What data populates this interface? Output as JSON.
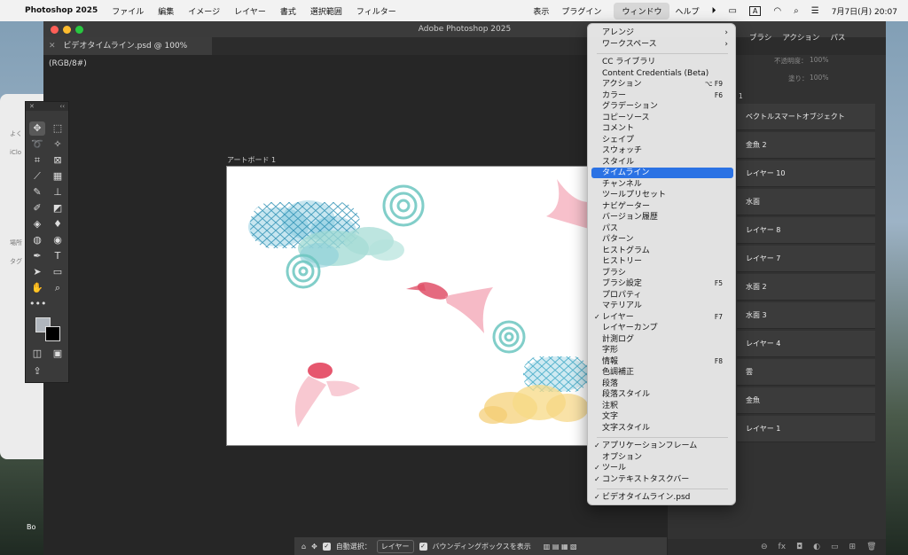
{
  "menubar": {
    "app_name": "Photoshop 2025",
    "left_items": [
      "ファイル",
      "編集",
      "イメージ",
      "レイヤー",
      "書式",
      "選択範囲",
      "フィルター"
    ],
    "right_items": [
      "表示",
      "プラグイン"
    ],
    "active_item": "ウィンドウ",
    "help": "ヘルプ",
    "input_indicator": "A",
    "datetime": "7月7日(月)  20:07"
  },
  "window": {
    "title": "Adobe Photoshop 2025",
    "document_tab": "ビデオタイムライン.psd @ 100% (RGB/8#)",
    "artboard_label": "アートボード 1"
  },
  "panels": {
    "tabs": [
      "ブラシ",
      "アクション",
      "パス"
    ],
    "opacity_label": "不透明度：",
    "opacity_value": "100%",
    "fill_label": "塗り：",
    "fill_value": "100%",
    "group_label": "1",
    "layers": [
      "ベクトルスマートオブジェクト",
      "金魚 2",
      "レイヤー 10",
      "水面",
      "レイヤー 8",
      "レイヤー 7",
      "水面 2",
      "水面 3",
      "レイヤー 4",
      "雲",
      "金魚",
      "レイヤー 1"
    ]
  },
  "finder": {
    "labels": [
      "よく",
      "iClo",
      "場所",
      "タグ"
    ],
    "dock_label": "Bo"
  },
  "optionsbar": {
    "auto_select_label": "自動選択：",
    "auto_select_value": "レイヤー",
    "bounding_box_label": "バウンディングボックスを表示"
  },
  "window_menu": {
    "items": [
      {
        "label": "アレンジ",
        "submenu": true
      },
      {
        "label": "ワークスペース",
        "submenu": true
      },
      {
        "separator": true
      },
      {
        "label": "CC ライブラリ"
      },
      {
        "label": "Content Credentials (Beta)"
      },
      {
        "label": "アクション",
        "shortcut": "⌥ F9"
      },
      {
        "label": "カラー",
        "shortcut": "F6"
      },
      {
        "label": "グラデーション"
      },
      {
        "label": "コピーソース"
      },
      {
        "label": "コメント"
      },
      {
        "label": "シェイプ"
      },
      {
        "label": "スウォッチ"
      },
      {
        "label": "スタイル"
      },
      {
        "label": "タイムライン",
        "highlighted": true
      },
      {
        "label": "チャンネル"
      },
      {
        "label": "ツールプリセット"
      },
      {
        "label": "ナビゲーター"
      },
      {
        "label": "バージョン履歴"
      },
      {
        "label": "パス"
      },
      {
        "label": "パターン"
      },
      {
        "label": "ヒストグラム"
      },
      {
        "label": "ヒストリー"
      },
      {
        "label": "ブラシ"
      },
      {
        "label": "ブラシ設定",
        "shortcut": "F5"
      },
      {
        "label": "プロパティ"
      },
      {
        "label": "マテリアル"
      },
      {
        "label": "レイヤー",
        "shortcut": "F7",
        "checked": true
      },
      {
        "label": "レイヤーカンプ"
      },
      {
        "label": "計測ログ"
      },
      {
        "label": "字形"
      },
      {
        "label": "情報",
        "shortcut": "F8"
      },
      {
        "label": "色調補正"
      },
      {
        "label": "段落"
      },
      {
        "label": "段落スタイル"
      },
      {
        "label": "注釈"
      },
      {
        "label": "文字"
      },
      {
        "label": "文字スタイル"
      },
      {
        "separator": true
      },
      {
        "label": "アプリケーションフレーム",
        "checked": true
      },
      {
        "label": "オプション"
      },
      {
        "label": "ツール",
        "checked": true
      },
      {
        "label": "コンテキストタスクバー",
        "checked": true
      },
      {
        "separator": true
      },
      {
        "label": "ビデオタイムライン.psd",
        "checked": true
      }
    ]
  },
  "colors": {
    "accent": "#2b72e4",
    "close": "#ff5f57",
    "minimize": "#febc2e",
    "maximize": "#28c840"
  }
}
